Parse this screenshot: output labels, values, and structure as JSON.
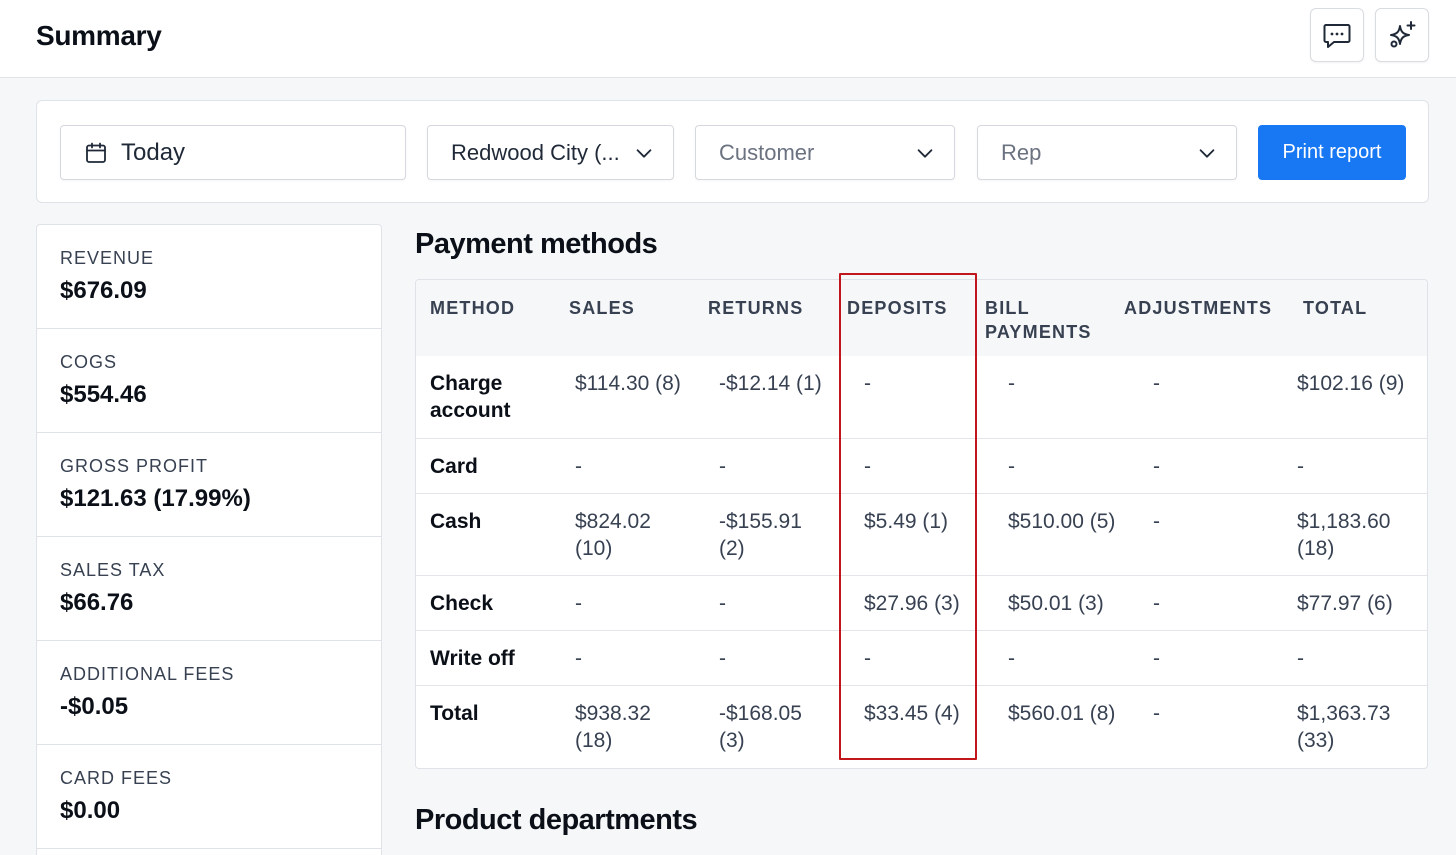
{
  "header": {
    "title": "Summary",
    "icons": [
      "chat-icon",
      "sparkle-icon"
    ]
  },
  "filters": {
    "date": "Today",
    "location": "Redwood City (...",
    "customer_placeholder": "Customer",
    "rep_placeholder": "Rep",
    "print_label": "Print report"
  },
  "stats": [
    {
      "label": "REVENUE",
      "value": "$676.09"
    },
    {
      "label": "COGS",
      "value": "$554.46"
    },
    {
      "label": "GROSS PROFIT",
      "value": "$121.63 (17.99%)"
    },
    {
      "label": "SALES TAX",
      "value": "$66.76"
    },
    {
      "label": "ADDITIONAL FEES",
      "value": "-$0.05"
    },
    {
      "label": "CARD FEES",
      "value": "$0.00"
    }
  ],
  "payment_methods": {
    "title": "Payment methods",
    "columns": [
      "METHOD",
      "SALES",
      "RETURNS",
      "DEPOSITS",
      "BILL PAYMENTS",
      "ADJUSTMENTS",
      "TOTAL"
    ],
    "rows": [
      {
        "method": "Charge account",
        "sales": "$114.30 (8)",
        "returns": "-$12.14 (1)",
        "deposits": "-",
        "bill_payments": "-",
        "adjustments": "-",
        "total": "$102.16 (9)"
      },
      {
        "method": "Card",
        "sales": "-",
        "returns": "-",
        "deposits": "-",
        "bill_payments": "-",
        "adjustments": "-",
        "total": "-"
      },
      {
        "method": "Cash",
        "sales": "$824.02 (10)",
        "returns": "-$155.91 (2)",
        "deposits": "$5.49 (1)",
        "bill_payments": "$510.00 (5)",
        "adjustments": "-",
        "total": "$1,183.60 (18)"
      },
      {
        "method": "Check",
        "sales": "-",
        "returns": "-",
        "deposits": "$27.96 (3)",
        "bill_payments": "$50.01 (3)",
        "adjustments": "-",
        "total": "$77.97 (6)"
      },
      {
        "method": "Write off",
        "sales": "-",
        "returns": "-",
        "deposits": "-",
        "bill_payments": "-",
        "adjustments": "-",
        "total": "-"
      },
      {
        "method": "Total",
        "sales": "$938.32 (18)",
        "returns": "-$168.05 (3)",
        "deposits": "$33.45 (4)",
        "bill_payments": "$560.01 (8)",
        "adjustments": "-",
        "total": "$1,363.73 (33)"
      }
    ]
  },
  "product_departments": {
    "title": "Product departments"
  },
  "colors": {
    "accent": "#1877f2",
    "highlight_box": "#c0161c"
  }
}
